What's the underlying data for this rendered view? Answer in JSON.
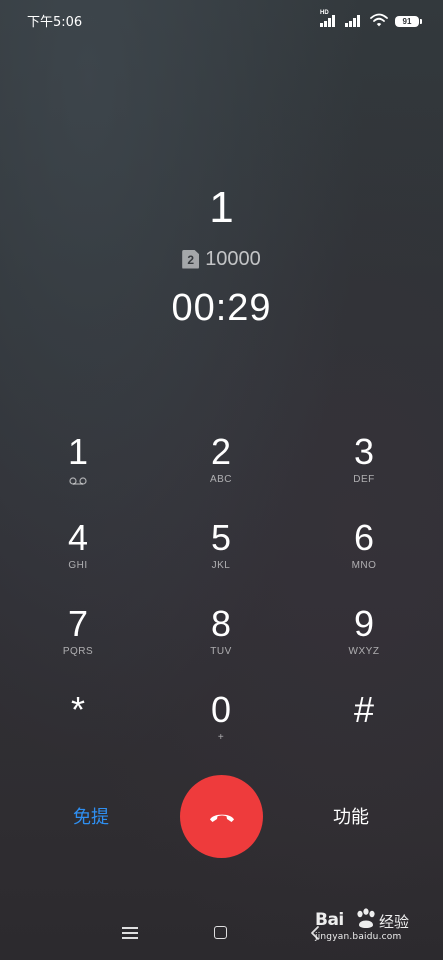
{
  "status_bar": {
    "time": "下午5:06",
    "sim1_tag": "HD",
    "battery_level": "91",
    "icons": [
      "hd-signal-icon",
      "signal-icon",
      "wifi-icon",
      "battery-icon"
    ]
  },
  "call": {
    "name": "1",
    "sim_slot": "2",
    "number": "10000",
    "duration": "00:29"
  },
  "keypad": {
    "keys": [
      {
        "digit": "1",
        "letters": "",
        "icon": "voicemail-icon"
      },
      {
        "digit": "2",
        "letters": "ABC"
      },
      {
        "digit": "3",
        "letters": "DEF"
      },
      {
        "digit": "4",
        "letters": "GHI"
      },
      {
        "digit": "5",
        "letters": "JKL"
      },
      {
        "digit": "6",
        "letters": "MNO"
      },
      {
        "digit": "7",
        "letters": "PQRS"
      },
      {
        "digit": "8",
        "letters": "TUV"
      },
      {
        "digit": "9",
        "letters": "WXYZ"
      },
      {
        "digit": "*",
        "letters": ""
      },
      {
        "digit": "0",
        "letters": "+"
      },
      {
        "digit": "#",
        "letters": ""
      }
    ]
  },
  "actions": {
    "speaker_label": "免提",
    "functions_label": "功能",
    "hangup_icon": "phone-hangup-icon",
    "hangup_color": "#ee3b3c",
    "speaker_color": "#2f8ff1"
  },
  "nav_bar": {
    "icons": [
      "menu-icon",
      "home-icon",
      "back-icon"
    ]
  },
  "watermark": {
    "brand": "Bai",
    "brand_suffix": "经验",
    "domain": "jingyan.baidu.com"
  }
}
